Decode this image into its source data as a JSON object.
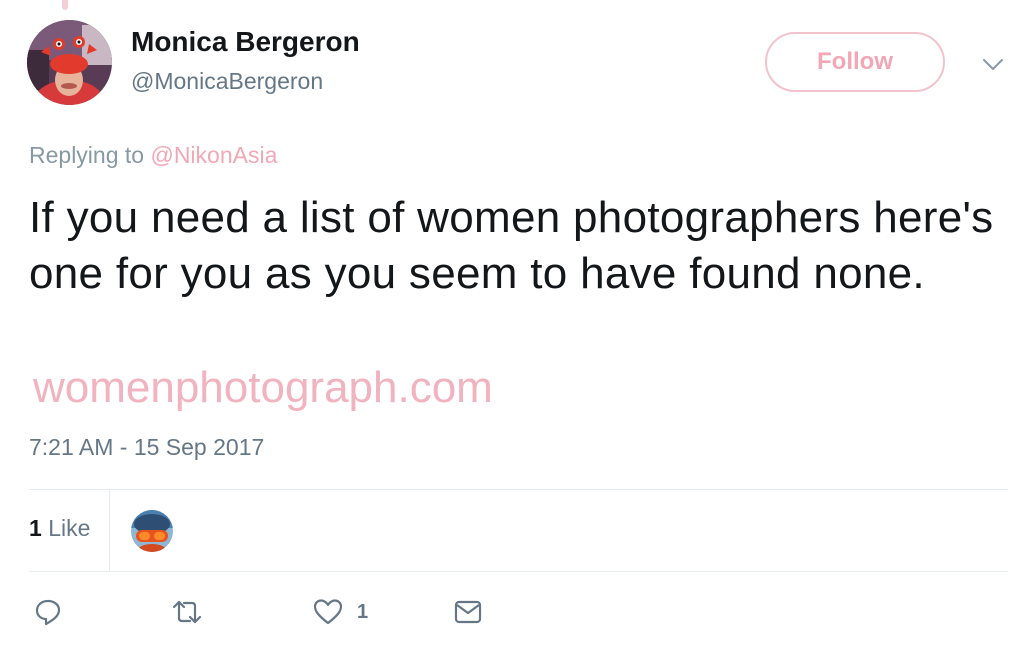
{
  "author": {
    "name": "Monica Bergeron",
    "handle": "@MonicaBergeron"
  },
  "header": {
    "follow_label": "Follow"
  },
  "reply_context": {
    "prefix": "Replying to",
    "mention": "@NikonAsia"
  },
  "tweet": {
    "text": "If you need a list of women photographers here's one for you as you seem to have found none.",
    "link": "womenphotograph.com",
    "timestamp": "7:21 AM - 15 Sep 2017"
  },
  "stats": {
    "likes_count": "1",
    "likes_label": "Like"
  },
  "actions": {
    "like_count": "1"
  },
  "colors": {
    "text": "#14171a",
    "secondary": "#657786",
    "accent_pink": "#f2a7b6",
    "divider": "#e6ecf0"
  },
  "icons": {
    "reply": "reply-icon",
    "retweet": "retweet-icon",
    "like": "heart-icon",
    "dm": "envelope-icon",
    "more": "chevron-down-icon"
  }
}
